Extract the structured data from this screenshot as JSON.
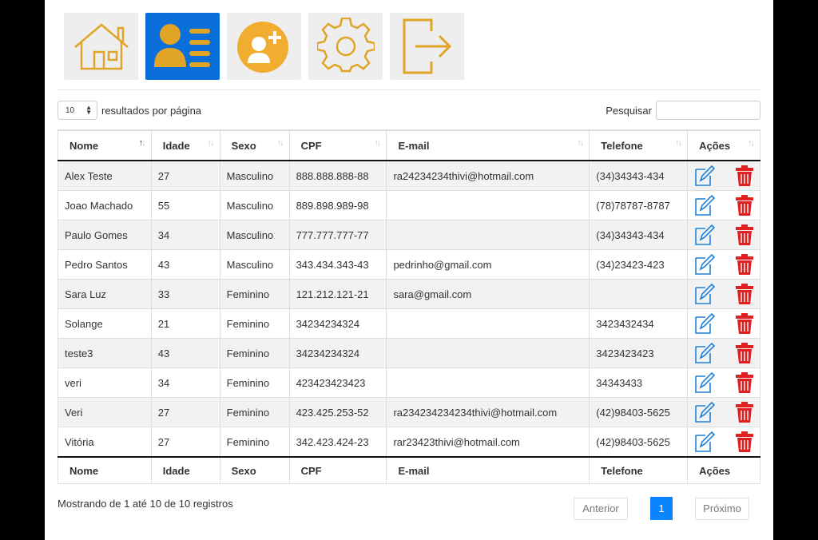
{
  "toolbar": {
    "items": [
      {
        "icon": "home-icon"
      },
      {
        "icon": "users-list-icon",
        "active": true
      },
      {
        "icon": "add-user-icon"
      },
      {
        "icon": "gear-icon"
      },
      {
        "icon": "logout-icon"
      }
    ],
    "accent_color": "#e0a427",
    "active_color": "#0a6fd8"
  },
  "length": {
    "value": "10",
    "label": "resultados por página"
  },
  "search": {
    "label": "Pesquisar"
  },
  "table": {
    "columns": [
      "Nome",
      "Idade",
      "Sexo",
      "CPF",
      "E-mail",
      "Telefone",
      "Ações"
    ],
    "rows": [
      [
        "Alex Teste",
        "27",
        "Masculino",
        "888.888.888-88",
        "ra24234234thivi@hotmail.com",
        "(34)34343-434"
      ],
      [
        "Joao Machado",
        "55",
        "Masculino",
        "889.898.989-98",
        "",
        "(78)78787-8787"
      ],
      [
        "Paulo Gomes",
        "34",
        "Masculino",
        "777.777.777-77",
        "",
        "(34)34343-434"
      ],
      [
        "Pedro Santos",
        "43",
        "Masculino",
        "343.434.343-43",
        "pedrinho@gmail.com",
        "(34)23423-423"
      ],
      [
        "Sara Luz",
        "33",
        "Feminino",
        "121.212.121-21",
        "sara@gmail.com",
        ""
      ],
      [
        "Solange",
        "21",
        "Feminino",
        "34234234324",
        "",
        "3423432434"
      ],
      [
        "teste3",
        "43",
        "Feminino",
        "34234234324",
        "",
        "3423423423"
      ],
      [
        "veri",
        "34",
        "Feminino",
        "423423423423",
        "",
        "34343433"
      ],
      [
        "Veri",
        "27",
        "Feminino",
        "423.425.253-52",
        "ra234234234234thivi@hotmail.com",
        "(42)98403-5625"
      ],
      [
        "Vitória",
        "27",
        "Feminino",
        "342.423.424-23",
        "rar23423thivi@hotmail.com",
        "(42)98403-5625"
      ]
    ],
    "edit_icon_color": "#1e7fd6",
    "delete_icon_color": "#e02020"
  },
  "footer": {
    "info": "Mostrando de 1 até 10 de 10 registros",
    "prev": "Anterior",
    "page": "1",
    "next": "Próximo"
  }
}
